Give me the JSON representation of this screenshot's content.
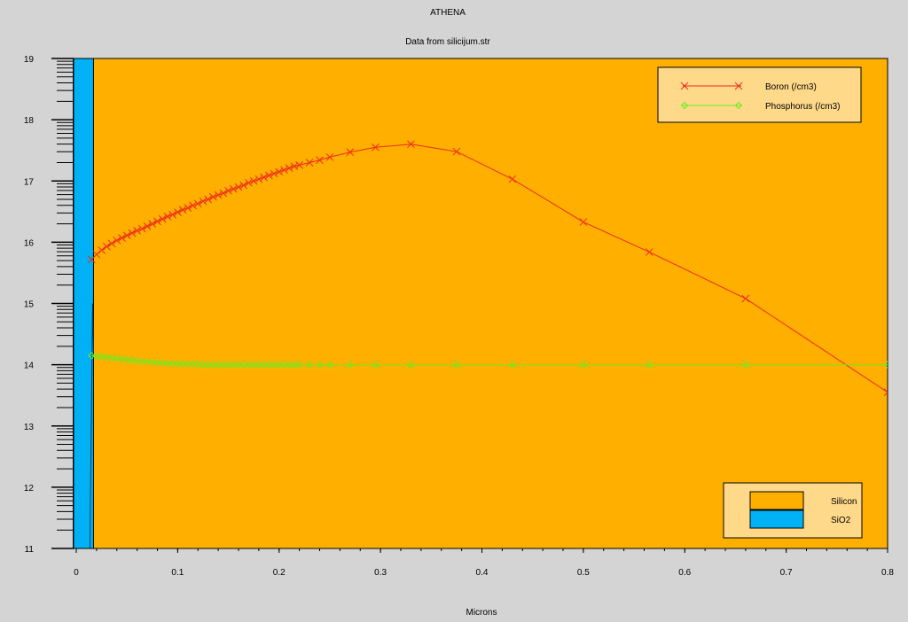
{
  "chart_data": {
    "type": "line",
    "title": "ATHENA",
    "subtitle": "Data from silicijum.str",
    "xlabel": "Microns",
    "ylabel": "",
    "xlim": [
      0,
      0.8
    ],
    "ylim": [
      11,
      19
    ],
    "x_ticks": [
      0,
      0.1,
      0.2,
      0.3,
      0.4,
      0.5,
      0.6,
      0.7,
      0.8
    ],
    "x_tick_labels": [
      "0",
      "0.1",
      "0.2",
      "0.3",
      "0.4",
      "0.5",
      "0.6",
      "0.7",
      "0.8"
    ],
    "y_ticks": [
      11,
      12,
      13,
      14,
      15,
      16,
      17,
      18,
      19
    ],
    "y_tick_labels": [
      "11",
      "12",
      "13",
      "14",
      "15",
      "16",
      "17",
      "18",
      "19"
    ],
    "y_scale_note": "log10",
    "grid": false,
    "legend_position": "top-right",
    "series": [
      {
        "name": "Boron (/cm3)",
        "color": "#ee2a1a",
        "marker": "x",
        "x": [
          0.015,
          0.02,
          0.025,
          0.03,
          0.035,
          0.04,
          0.045,
          0.05,
          0.055,
          0.06,
          0.065,
          0.07,
          0.075,
          0.08,
          0.085,
          0.09,
          0.095,
          0.1,
          0.105,
          0.11,
          0.115,
          0.12,
          0.125,
          0.13,
          0.135,
          0.14,
          0.145,
          0.15,
          0.155,
          0.16,
          0.165,
          0.17,
          0.175,
          0.18,
          0.185,
          0.19,
          0.195,
          0.2,
          0.205,
          0.21,
          0.215,
          0.22,
          0.23,
          0.24,
          0.25,
          0.27,
          0.295,
          0.33,
          0.375,
          0.43,
          0.5,
          0.565,
          0.66,
          0.8
        ],
        "values": [
          15.72,
          15.8,
          15.87,
          15.93,
          15.98,
          16.03,
          16.07,
          16.11,
          16.15,
          16.19,
          16.22,
          16.26,
          16.3,
          16.34,
          16.38,
          16.42,
          16.45,
          16.49,
          16.53,
          16.56,
          16.6,
          16.63,
          16.67,
          16.7,
          16.74,
          16.77,
          16.8,
          16.84,
          16.87,
          16.9,
          16.93,
          16.97,
          17.0,
          17.03,
          17.06,
          17.09,
          17.12,
          17.15,
          17.18,
          17.21,
          17.24,
          17.26,
          17.3,
          17.34,
          17.39,
          17.47,
          17.55,
          17.6,
          17.48,
          17.03,
          16.33,
          15.84,
          15.08,
          13.55
        ]
      },
      {
        "name": "Phosphorus (/cm3)",
        "color": "#66ee22",
        "marker": "diamond",
        "x": [
          0.015,
          0.02,
          0.025,
          0.03,
          0.035,
          0.04,
          0.045,
          0.05,
          0.055,
          0.06,
          0.065,
          0.07,
          0.075,
          0.08,
          0.085,
          0.09,
          0.095,
          0.1,
          0.105,
          0.11,
          0.115,
          0.12,
          0.125,
          0.13,
          0.135,
          0.14,
          0.145,
          0.15,
          0.155,
          0.16,
          0.165,
          0.17,
          0.175,
          0.18,
          0.185,
          0.19,
          0.195,
          0.2,
          0.205,
          0.21,
          0.215,
          0.22,
          0.23,
          0.24,
          0.25,
          0.27,
          0.295,
          0.33,
          0.375,
          0.43,
          0.5,
          0.565,
          0.66,
          0.8
        ],
        "values": [
          14.15,
          14.14,
          14.13,
          14.12,
          14.11,
          14.1,
          14.09,
          14.08,
          14.07,
          14.06,
          14.05,
          14.05,
          14.04,
          14.03,
          14.03,
          14.02,
          14.02,
          14.02,
          14.01,
          14.01,
          14.01,
          14.01,
          14.0,
          14.0,
          14.0,
          14.0,
          14.0,
          14.0,
          14.0,
          14.0,
          14.0,
          14.0,
          14.0,
          14.0,
          14.0,
          14.0,
          14.0,
          14.0,
          14.0,
          14.0,
          14.0,
          14.0,
          14.0,
          14.0,
          14.0,
          14.0,
          14.0,
          14.0,
          14.0,
          14.0,
          14.0,
          14.0,
          14.0,
          14.0
        ]
      }
    ],
    "regions": [
      {
        "name": "Silicon",
        "color": "#ffaf00",
        "x": [
          0.017,
          0.8
        ]
      },
      {
        "name": "SiO2",
        "color": "#00b1f5",
        "x": [
          -0.003,
          0.017
        ]
      }
    ],
    "region_legend_position": "bottom-right",
    "colors": {
      "background": "#d4d4d4",
      "legend_fill": "#ffd98a"
    }
  }
}
